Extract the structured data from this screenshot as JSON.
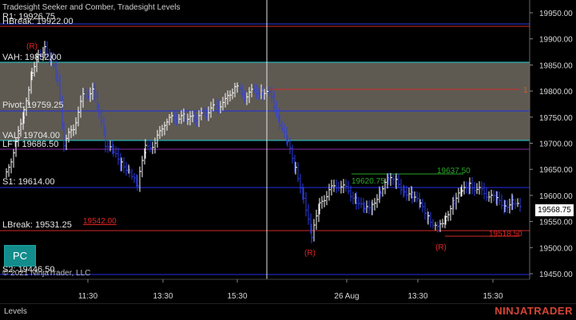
{
  "indicator_title": "Tradesight Seeker and Comber, Tradesight Levels",
  "copyright": "© 2021 NinjaTrader, LLC",
  "brand": "NINJATRADER",
  "tab_label": "Levels",
  "pc_button_label": "PC",
  "last_price_label": "19568.75",
  "level_labels": {
    "r1": "R1: 19926.75",
    "hbreak": "HBreak: 19922.00",
    "vah": "VAH: 19852.00",
    "pivot": "Pivot: 19759.25",
    "val": "VAL: 19704.00",
    "lft": "LFT: 19686.50",
    "s1": "S1: 19614.00",
    "lbreak": "LBreak: 19531.25",
    "s2": "S2: 19446.50"
  },
  "annotations": {
    "r_marks": [
      "(R)",
      "(R)",
      "(R)"
    ],
    "red_19542": "19542.00",
    "red_1": "1",
    "green_19620": "19620.75",
    "green_19637": "19637.50",
    "red_19518": "19518.50"
  },
  "colors": {
    "background": "#000000",
    "value_area": "#5e5a52",
    "blue_line": "#1f2fe6",
    "cyan_line": "#25d0d0",
    "red_line": "#d12a2a",
    "purple_line": "#8a2aa8",
    "bar_up": "#ffffff",
    "bar_down": "#2d3ee8",
    "green_text": "#2aa52a",
    "cyan_text": "#2ad6d6",
    "red_text": "#e02424"
  },
  "chart_data": {
    "type": "bar",
    "title": "",
    "x_tick_labels": [
      "11:30",
      "13:30",
      "15:30",
      "26 Aug",
      "13:30",
      "15:30"
    ],
    "y_tick_labels": [
      "19950.00",
      "19900.00",
      "19850.00",
      "19800.00",
      "19750.00",
      "19700.00",
      "19650.00",
      "19600.00",
      "19550.00",
      "19500.00",
      "19450.00"
    ],
    "ylim": [
      19430,
      19965
    ],
    "levels": [
      {
        "name": "R1",
        "value": 19926.75
      },
      {
        "name": "HBreak",
        "value": 19922.0
      },
      {
        "name": "VAH",
        "value": 19852.0
      },
      {
        "name": "Pivot",
        "value": 19759.25
      },
      {
        "name": "VAL",
        "value": 19704.0
      },
      {
        "name": "LFT",
        "value": 19686.5
      },
      {
        "name": "S1",
        "value": 19614.0
      },
      {
        "name": "LBreak",
        "value": 19531.25
      },
      {
        "name": "S2",
        "value": 19446.5
      }
    ],
    "last_price": 19568.75,
    "grid": false,
    "legend": "none"
  }
}
